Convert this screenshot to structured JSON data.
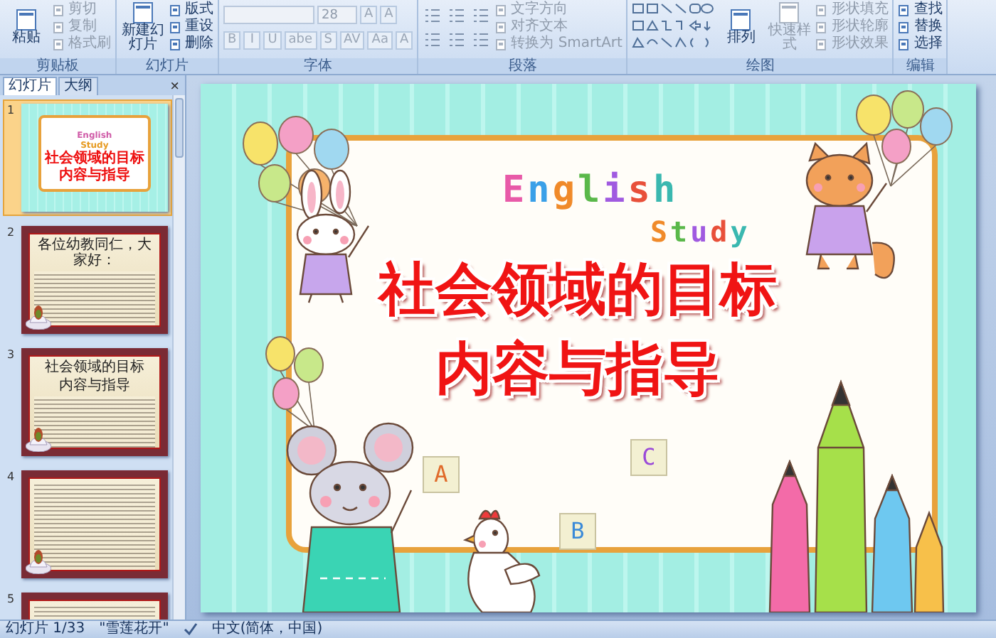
{
  "ribbon": {
    "groups": [
      {
        "label": "剪贴板",
        "kind": "stack",
        "items": [
          {
            "kind": "big",
            "label": "粘贴",
            "disabled": false
          },
          {
            "kind": "small",
            "label": "剪切",
            "disabled": true
          },
          {
            "kind": "small",
            "label": "复制",
            "disabled": true
          },
          {
            "kind": "small",
            "label": "格式刷",
            "disabled": true
          }
        ]
      },
      {
        "label": "幻灯片",
        "kind": "stack",
        "items": [
          {
            "kind": "big",
            "label": "新建幻灯片",
            "disabled": false
          },
          {
            "kind": "small",
            "label": "版式",
            "disabled": false
          },
          {
            "kind": "small",
            "label": "重设",
            "disabled": false
          },
          {
            "kind": "small",
            "label": "删除",
            "disabled": false
          }
        ]
      },
      {
        "label": "字体",
        "kind": "rows",
        "top": [
          {
            "kind": "field",
            "disabled": true
          },
          {
            "kind": "field",
            "value": "28",
            "disabled": true
          },
          {
            "kind": "glyph",
            "label": "A",
            "disabled": true
          },
          {
            "kind": "glyph",
            "label": "A",
            "disabled": true
          }
        ],
        "bottom": [
          {
            "kind": "glyph",
            "label": "B",
            "disabled": true
          },
          {
            "kind": "glyph",
            "label": "I",
            "disabled": true
          },
          {
            "kind": "glyph",
            "label": "U",
            "disabled": true
          },
          {
            "kind": "glyph",
            "label": "abe",
            "disabled": true
          },
          {
            "kind": "glyph",
            "label": "S",
            "disabled": true
          },
          {
            "kind": "glyph",
            "label": "AV",
            "disabled": true
          },
          {
            "kind": "glyph",
            "label": "Aa",
            "disabled": true
          },
          {
            "kind": "glyph",
            "label": "A",
            "disabled": true
          }
        ]
      },
      {
        "label": "段落",
        "kind": "palette-stack",
        "items": [
          {
            "kind": "small",
            "label": "文字方向",
            "disabled": true
          },
          {
            "kind": "small",
            "label": "对齐文本",
            "disabled": true
          },
          {
            "kind": "small",
            "label": "转换为 SmartArt",
            "disabled": true
          }
        ]
      },
      {
        "label": "绘图",
        "kind": "shapes-stack",
        "items": [
          {
            "kind": "big",
            "label": "排列",
            "disabled": false
          },
          {
            "kind": "big",
            "label": "快速样式",
            "disabled": true
          },
          {
            "kind": "small",
            "label": "形状填充",
            "disabled": true
          },
          {
            "kind": "small",
            "label": "形状轮廓",
            "disabled": true
          },
          {
            "kind": "small",
            "label": "形状效果",
            "disabled": true
          }
        ]
      },
      {
        "label": "编辑",
        "kind": "stack",
        "items": [
          {
            "kind": "small",
            "label": "查找",
            "disabled": false
          },
          {
            "kind": "small",
            "label": "替换",
            "disabled": false
          },
          {
            "kind": "small",
            "label": "选择",
            "disabled": false
          }
        ]
      }
    ]
  },
  "panel": {
    "tabs": [
      {
        "label": "幻灯片",
        "selected": true
      },
      {
        "label": "大纲",
        "selected": false
      }
    ],
    "close": "×",
    "slides": [
      {
        "number": "1",
        "kind": "cover",
        "selected": true,
        "english": "English",
        "study": "Study",
        "title_lines": [
          "社会领域的目标",
          "内容与指导"
        ]
      },
      {
        "number": "2",
        "kind": "text",
        "selected": false,
        "heading_lines": [
          "各位幼教同仁，大家好："
        ]
      },
      {
        "number": "3",
        "kind": "text",
        "selected": false,
        "heading_lines": [
          "社会领域的目标",
          "内容与指导"
        ]
      },
      {
        "number": "4",
        "kind": "text",
        "selected": false
      },
      {
        "number": "5",
        "kind": "text",
        "selected": false
      }
    ]
  },
  "slide": {
    "english": "English",
    "study": "Study",
    "title_lines": [
      "社会领域的目标",
      "内容与指导"
    ],
    "blocks": [
      "A",
      "B",
      "C"
    ]
  },
  "status_bar": {
    "slide_counter": "幻灯片 1/33",
    "theme": "\"雪莲花开\"",
    "language": "中文(简体，中国)"
  }
}
